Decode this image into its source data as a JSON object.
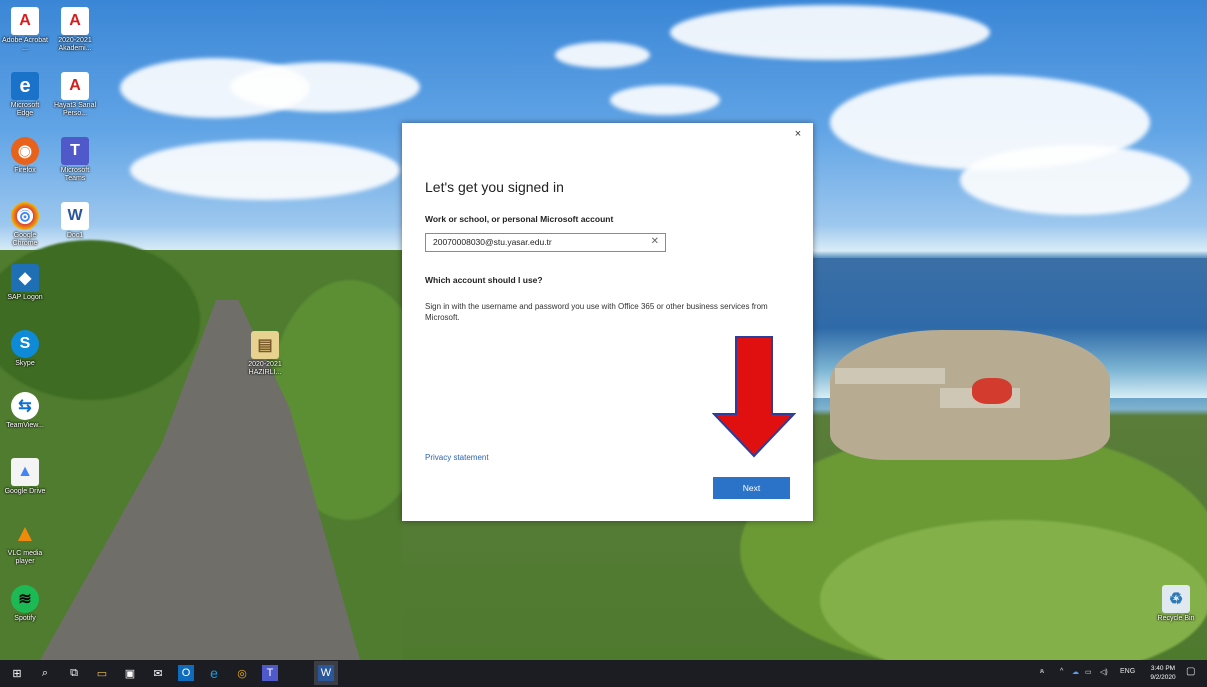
{
  "desktop": {
    "icons": [
      {
        "label": "Adobe Acrobat ...",
        "icon": "acrobat-icon",
        "color": "#d3201f",
        "glyph": "A"
      },
      {
        "label": "2020-2021 Akademi...",
        "icon": "pdf-icon",
        "color": "#d3201f",
        "glyph": "A"
      },
      {
        "label": "Microsoft Edge",
        "icon": "edge-icon",
        "color": "#1a73c8",
        "glyph": "e"
      },
      {
        "label": "Hayat3 Sanal Perso...",
        "icon": "pdf-icon",
        "color": "#d3201f",
        "glyph": "A"
      },
      {
        "label": "Firefox",
        "icon": "firefox-icon",
        "color": "#e8621c",
        "glyph": "◉"
      },
      {
        "label": "Microsoft Teams",
        "icon": "teams-icon",
        "color": "#5059c9",
        "glyph": "T"
      },
      {
        "label": "Google Chrome",
        "icon": "chrome-icon",
        "color": "#3a9a46",
        "glyph": "◎"
      },
      {
        "label": "Doc1",
        "icon": "word-doc-icon",
        "color": "#2b579a",
        "glyph": "W"
      },
      {
        "label": "SAP Logon",
        "icon": "sap-logon-icon",
        "color": "#1f6fb5",
        "glyph": "◆"
      },
      {
        "label": "2020-2021 HAZIRLI...",
        "icon": "file-icon",
        "color": "#e8d28f",
        "glyph": "▤"
      },
      {
        "label": "Skype",
        "icon": "skype-icon",
        "color": "#0e8ad6",
        "glyph": "S"
      },
      {
        "label": "TeamView...",
        "icon": "teamviewer-icon",
        "color": "#0e6fd1",
        "glyph": "⇆"
      },
      {
        "label": "Google Drive",
        "icon": "google-drive-icon",
        "color": "#f2f2f2",
        "glyph": "▲"
      },
      {
        "label": "VLC media player",
        "icon": "vlc-icon",
        "color": "#f08a0b",
        "glyph": "▲"
      },
      {
        "label": "Spotify",
        "icon": "spotify-icon",
        "color": "#1db954",
        "glyph": "≋"
      },
      {
        "label": "Recycle Bin",
        "icon": "recycle-bin-icon",
        "color": "#bcd0dc",
        "glyph": "♻"
      }
    ]
  },
  "dialog": {
    "title": "Let's get you signed in",
    "field_label": "Work or school, or personal Microsoft account",
    "email_value": "20070008030@stu.yasar.edu.tr",
    "question": "Which account should I use?",
    "description": "Sign in with the username and password you use with Office 365 or other business services from Microsoft.",
    "privacy_link": "Privacy statement",
    "next_label": "Next",
    "close_glyph": "×",
    "clear_glyph": "✕"
  },
  "annotation": {
    "arrow_color": "#e01010",
    "arrow_border": "#2a3e9e"
  },
  "taskbar": {
    "icons": [
      {
        "name": "start-icon",
        "glyph": "⊞"
      },
      {
        "name": "search-icon",
        "glyph": "⌕"
      },
      {
        "name": "task-view-icon",
        "glyph": "⧉"
      },
      {
        "name": "file-explorer-icon",
        "glyph": "▭"
      },
      {
        "name": "store-icon",
        "glyph": "▣"
      },
      {
        "name": "mail-icon",
        "glyph": "✉"
      },
      {
        "name": "outlook-icon",
        "glyph": "O"
      },
      {
        "name": "edge-icon",
        "glyph": "e"
      },
      {
        "name": "chrome-icon",
        "glyph": "◎"
      },
      {
        "name": "teams-icon",
        "glyph": "T"
      },
      {
        "name": "word-icon",
        "glyph": "W"
      }
    ],
    "tray": {
      "people": "ጰ",
      "chevron": "^",
      "language": "ENG",
      "time": "3:40 PM",
      "date": "9/2/2020",
      "notification": "▢"
    }
  }
}
